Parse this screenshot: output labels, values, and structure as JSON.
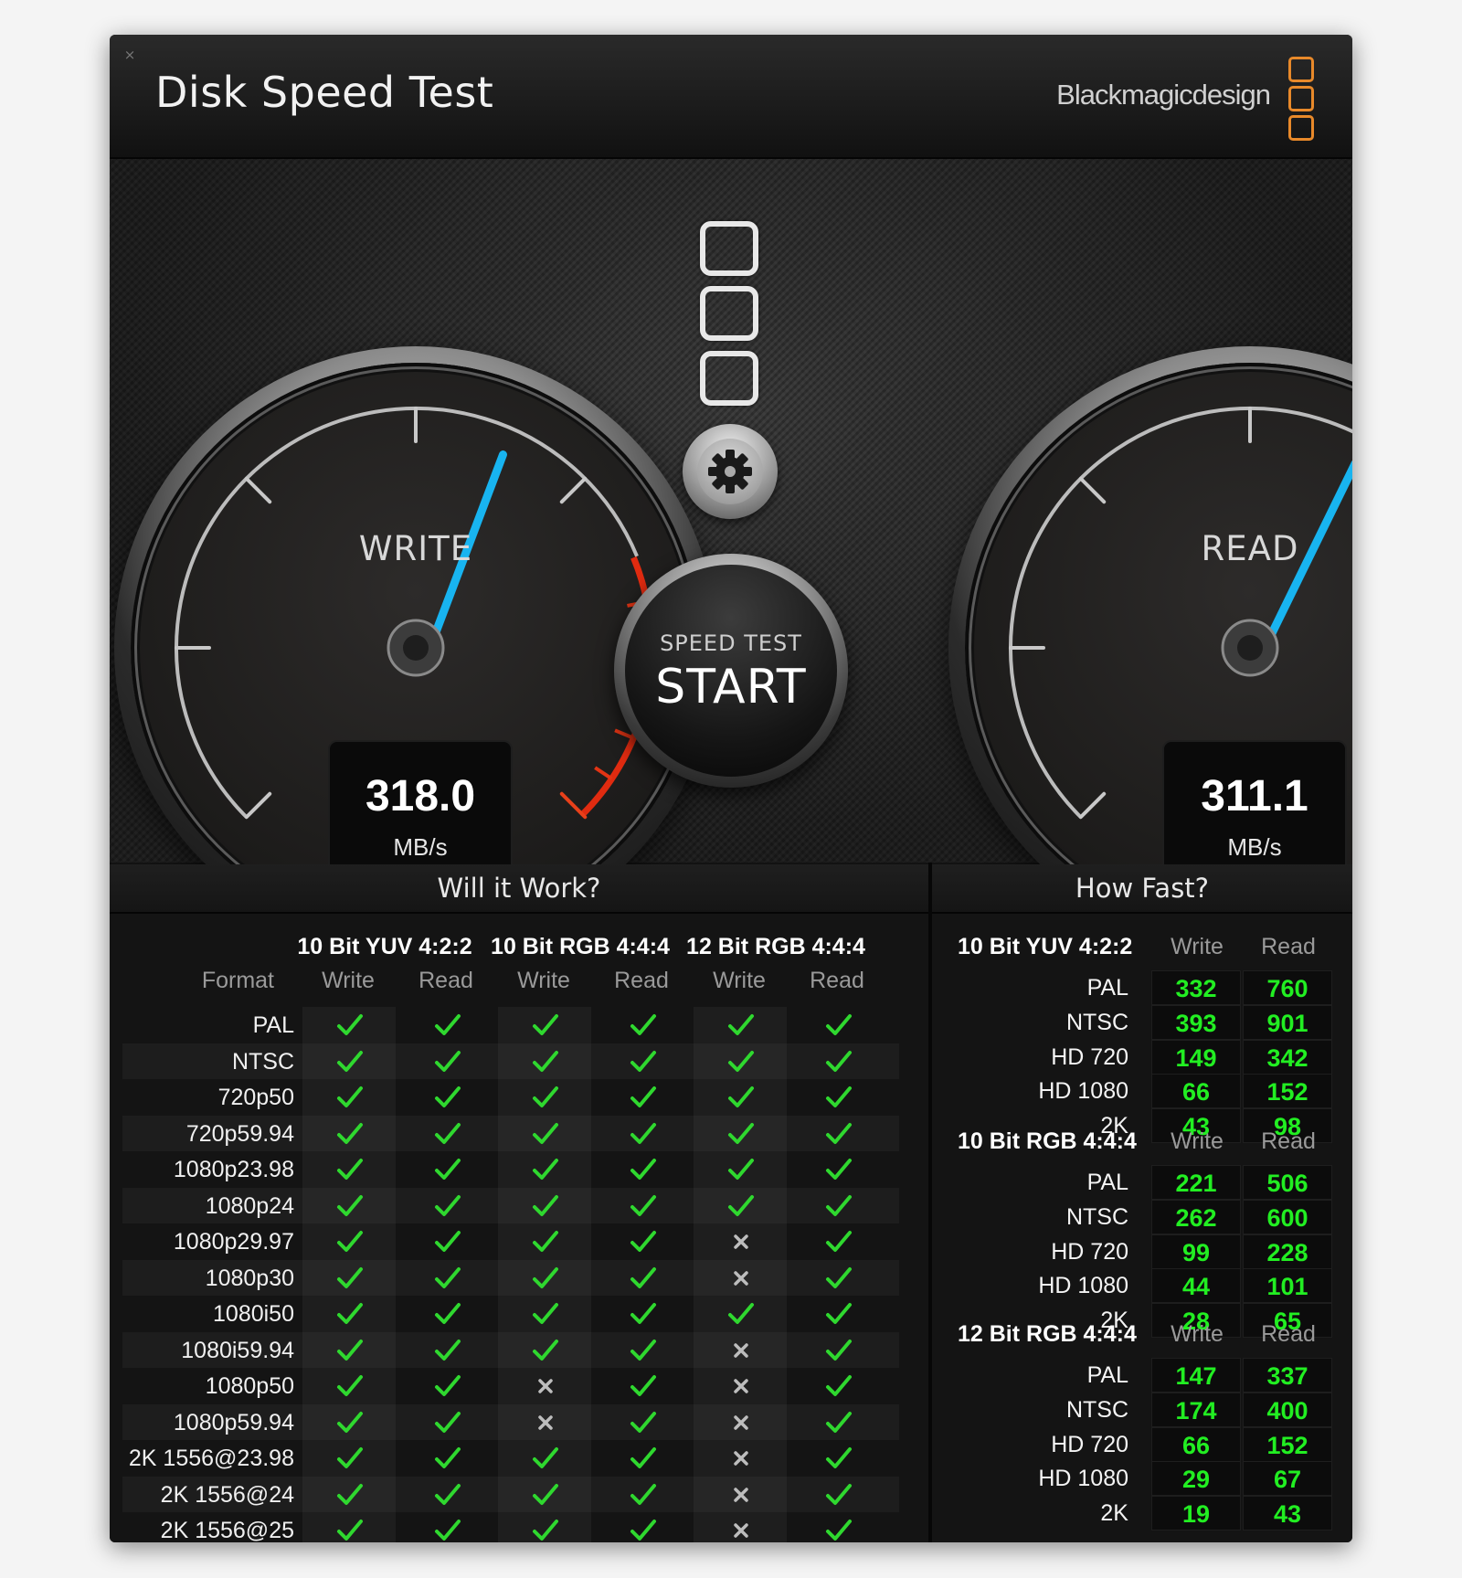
{
  "window": {
    "close_glyph": "×",
    "title": "Disk Speed Test",
    "brand": "Blackmagicdesign",
    "brand_color": "#e8892a"
  },
  "gauges": {
    "write": {
      "label": "WRITE",
      "value": "318.0",
      "unit": "MB/s",
      "needle_fraction": 0.59
    },
    "read": {
      "label": "READ",
      "value": "311.1",
      "unit": "MB/s",
      "needle_fraction": 0.61
    }
  },
  "controls": {
    "settings_icon": "gear-icon",
    "start_sub": "SPEED TEST",
    "start_main": "START"
  },
  "will_it_work": {
    "title": "Will it Work?",
    "format_header": "Format",
    "groups": [
      "10 Bit YUV 4:2:2",
      "10 Bit RGB 4:4:4",
      "12 Bit RGB 4:4:4"
    ],
    "sub_headers": [
      "Write",
      "Read",
      "Write",
      "Read",
      "Write",
      "Read"
    ],
    "rows": [
      {
        "format": "PAL",
        "checks": [
          true,
          true,
          true,
          true,
          true,
          true
        ]
      },
      {
        "format": "NTSC",
        "checks": [
          true,
          true,
          true,
          true,
          true,
          true
        ]
      },
      {
        "format": "720p50",
        "checks": [
          true,
          true,
          true,
          true,
          true,
          true
        ]
      },
      {
        "format": "720p59.94",
        "checks": [
          true,
          true,
          true,
          true,
          true,
          true
        ]
      },
      {
        "format": "1080p23.98",
        "checks": [
          true,
          true,
          true,
          true,
          true,
          true
        ]
      },
      {
        "format": "1080p24",
        "checks": [
          true,
          true,
          true,
          true,
          true,
          true
        ]
      },
      {
        "format": "1080p29.97",
        "checks": [
          true,
          true,
          true,
          true,
          false,
          true
        ]
      },
      {
        "format": "1080p30",
        "checks": [
          true,
          true,
          true,
          true,
          false,
          true
        ]
      },
      {
        "format": "1080i50",
        "checks": [
          true,
          true,
          true,
          true,
          true,
          true
        ]
      },
      {
        "format": "1080i59.94",
        "checks": [
          true,
          true,
          true,
          true,
          false,
          true
        ]
      },
      {
        "format": "1080p50",
        "checks": [
          true,
          true,
          false,
          true,
          false,
          true
        ]
      },
      {
        "format": "1080p59.94",
        "checks": [
          true,
          true,
          false,
          true,
          false,
          true
        ]
      },
      {
        "format": "2K 1556@23.98",
        "checks": [
          true,
          true,
          true,
          true,
          false,
          true
        ]
      },
      {
        "format": "2K 1556@24",
        "checks": [
          true,
          true,
          true,
          true,
          false,
          true
        ]
      },
      {
        "format": "2K 1556@25",
        "checks": [
          true,
          true,
          true,
          true,
          false,
          true
        ]
      }
    ],
    "check_color": "#2fd82f",
    "cross_color": "#bdbdbd"
  },
  "how_fast": {
    "title": "How Fast?",
    "value_color": "#22ee22",
    "groups": [
      {
        "title": "10 Bit YUV 4:2:2",
        "write_label": "Write",
        "read_label": "Read",
        "rows": [
          {
            "label": "PAL",
            "write": "332",
            "read": "760"
          },
          {
            "label": "NTSC",
            "write": "393",
            "read": "901"
          },
          {
            "label": "HD 720",
            "write": "149",
            "read": "342"
          },
          {
            "label": "HD 1080",
            "write": "66",
            "read": "152"
          },
          {
            "label": "2K",
            "write": "43",
            "read": "98"
          }
        ]
      },
      {
        "title": "10 Bit RGB 4:4:4",
        "write_label": "Write",
        "read_label": "Read",
        "rows": [
          {
            "label": "PAL",
            "write": "221",
            "read": "506"
          },
          {
            "label": "NTSC",
            "write": "262",
            "read": "600"
          },
          {
            "label": "HD 720",
            "write": "99",
            "read": "228"
          },
          {
            "label": "HD 1080",
            "write": "44",
            "read": "101"
          },
          {
            "label": "2K",
            "write": "28",
            "read": "65"
          }
        ]
      },
      {
        "title": "12 Bit RGB 4:4:4",
        "write_label": "Write",
        "read_label": "Read",
        "rows": [
          {
            "label": "PAL",
            "write": "147",
            "read": "337"
          },
          {
            "label": "NTSC",
            "write": "174",
            "read": "400"
          },
          {
            "label": "HD 720",
            "write": "66",
            "read": "152"
          },
          {
            "label": "HD 1080",
            "write": "29",
            "read": "67"
          },
          {
            "label": "2K",
            "write": "19",
            "read": "43"
          }
        ]
      }
    ]
  }
}
